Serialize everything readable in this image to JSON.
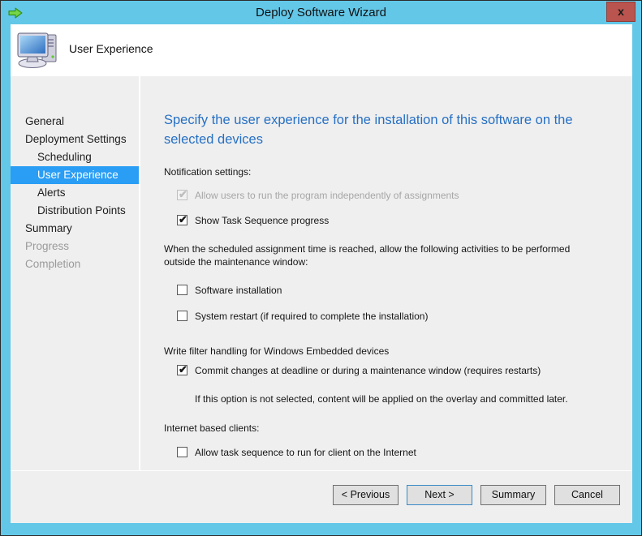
{
  "window": {
    "title": "Deploy Software Wizard",
    "close_label": "x",
    "titlebar_icon": "green-arrow-icon",
    "chrome_color": "#63c7e8",
    "close_color": "#b9544e"
  },
  "header": {
    "title": "User Experience",
    "icon": "computer-monitor-icon"
  },
  "sidebar": {
    "items": [
      {
        "label": "General",
        "indent": false,
        "state": "normal"
      },
      {
        "label": "Deployment Settings",
        "indent": false,
        "state": "normal"
      },
      {
        "label": "Scheduling",
        "indent": true,
        "state": "normal"
      },
      {
        "label": "User Experience",
        "indent": true,
        "state": "selected"
      },
      {
        "label": "Alerts",
        "indent": true,
        "state": "normal"
      },
      {
        "label": "Distribution Points",
        "indent": true,
        "state": "normal"
      },
      {
        "label": "Summary",
        "indent": false,
        "state": "normal"
      },
      {
        "label": "Progress",
        "indent": false,
        "state": "disabled"
      },
      {
        "label": "Completion",
        "indent": false,
        "state": "disabled"
      }
    ],
    "selected_color": "#2a9df4"
  },
  "content": {
    "heading": "Specify the user experience for the installation of this software on the selected devices",
    "heading_color": "#2670c4",
    "notification_label": "Notification settings:",
    "notification_options": [
      {
        "label": "Allow users to run the program independently of assignments",
        "checked": true,
        "enabled": false
      },
      {
        "label": "Show Task Sequence progress",
        "checked": true,
        "enabled": true
      }
    ],
    "maintenance_label": "When the scheduled assignment time is reached, allow the following activities to be performed outside the maintenance window:",
    "maintenance_options": [
      {
        "label": "Software installation",
        "checked": false,
        "enabled": true
      },
      {
        "label": "System restart (if required to complete the installation)",
        "checked": false,
        "enabled": true
      }
    ],
    "write_filter_label": "Write filter handling for Windows Embedded devices",
    "write_filter_options": [
      {
        "label": "Commit changes at deadline or during a maintenance window (requires restarts)",
        "checked": true,
        "enabled": true
      }
    ],
    "write_filter_note": "If this option is not selected, content will be applied on the overlay and committed later.",
    "internet_label": "Internet based clients:",
    "internet_options": [
      {
        "label": "Allow task sequence to run for client on the Internet",
        "checked": false,
        "enabled": true
      }
    ]
  },
  "footer": {
    "previous_label": "< Previous",
    "next_label": "Next >",
    "summary_label": "Summary",
    "cancel_label": "Cancel",
    "focused_button": "Next >"
  }
}
